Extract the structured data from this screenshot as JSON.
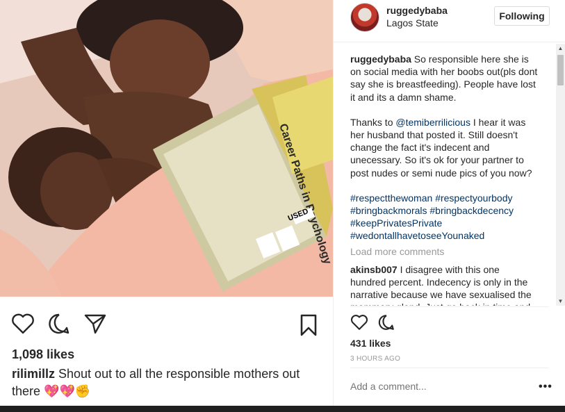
{
  "post": {
    "username": "ruggedybaba",
    "location": "Lagos State",
    "follow_label": "Following",
    "likes_right": "431 likes",
    "timestamp": "3 HOURS AGO",
    "add_comment_placeholder": "Add a comment...",
    "more_options": "•••"
  },
  "comments": {
    "c1_user": "ruggedybaba",
    "c1_text": " So responsible here she is on social media with her boobs out(pls dont say she is breastfeeding). People have lost it and its a damn shame.",
    "c1_p2_a": "Thanks to ",
    "c1_p2_mention": "@temiberrilicious",
    "c1_p2_b": " I hear it was her husband that posted it. Still doesn't change the fact it's indecent and unecessary. So it's ok for your partner to post nudes or semi nude pics of you now?",
    "hashtags": [
      "#respectthewoman",
      "#respectyourbody",
      "#bringbackmorals",
      "#bringbackdecency",
      "#keepPrivatesPrivate",
      "#wedontallhavetoseeYounaked"
    ],
    "load_more": "Load more comments",
    "c2_user": "akinsb007",
    "c2_text": " I disagree with this one hundred percent. Indecency is only in the narrative because we have sexualised the mammary gland. Just go back in time and look at"
  },
  "left_panel": {
    "likes": "1,098 likes",
    "caption_user": "rilimillz",
    "caption_text": " Shout out to all the responsible mothers out there ",
    "caption_emoji": "💖💖✊"
  },
  "photo": {
    "book_title": "Career Paths in Psychology",
    "book_sticker": "USED"
  },
  "icons": {
    "like": "heart-icon",
    "comment": "comment-icon",
    "share": "share-icon",
    "save": "bookmark-icon"
  }
}
